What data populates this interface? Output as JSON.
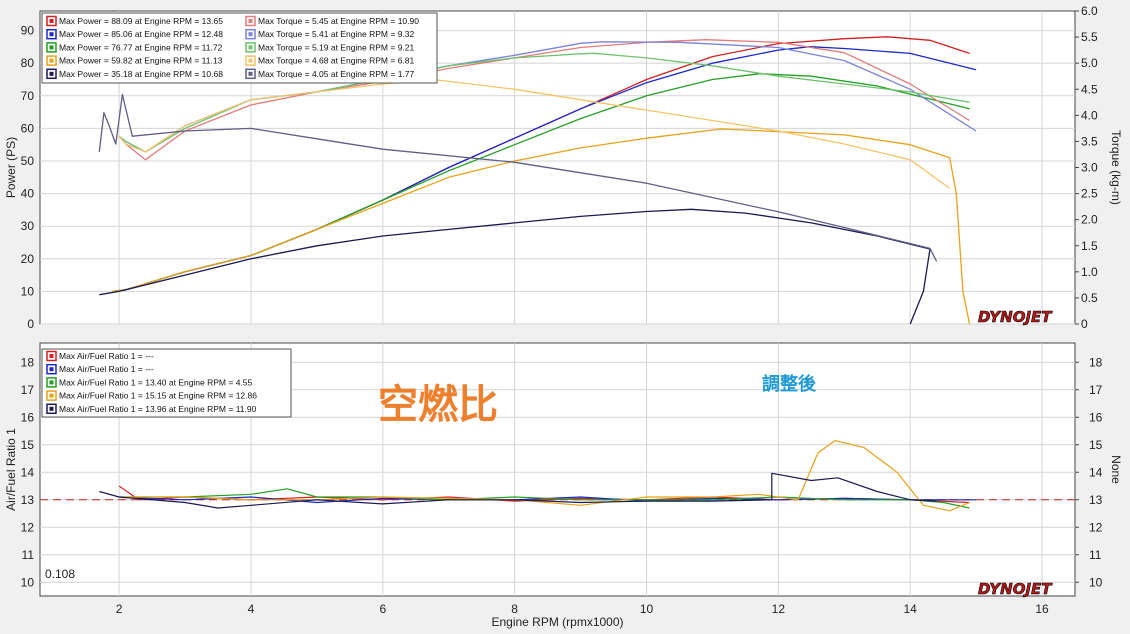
{
  "colors": {
    "red": "#d42020",
    "blue": "#1b28c8",
    "green": "#23a023",
    "orange": "#e8a21a",
    "navy": "#1a1a52",
    "red_torque": "#e57b7b",
    "blue_torque": "#7a84d9",
    "green_torque": "#6fc26f",
    "orange_torque": "#f2c469",
    "navy_torque": "#5e5e86",
    "annotation_orange": "#ee7f2d",
    "annotation_blue": "#1d9ad6",
    "af_reference": "#c82020"
  },
  "annotations": {
    "chart_title_jp": "空燃比",
    "status_jp": "調整後",
    "corner_value": "0.108",
    "logo": "DYNOJET"
  },
  "chart_data": [
    {
      "type": "line",
      "ylabel": "Power (PS)",
      "y2label": "Torque (kg-m)",
      "xlim": [
        0.8,
        16.5
      ],
      "ylim": [
        0,
        96
      ],
      "y2lim": [
        0,
        6.0
      ],
      "x_ticks": [
        "2",
        "4",
        "6",
        "8",
        "10",
        "12",
        "14",
        "16"
      ],
      "y_ticks": [
        "0",
        "10",
        "20",
        "30",
        "40",
        "50",
        "60",
        "70",
        "80",
        "90"
      ],
      "y2_ticks": [
        "0",
        "0.5",
        "1.0",
        "1.5",
        "2.0",
        "2.5",
        "3.0",
        "3.5",
        "4.0",
        "4.5",
        "5.0",
        "5.5",
        "6.0"
      ],
      "grid": true,
      "legend_position": "top-left",
      "legend": [
        [
          "Max Power = 88.09 at Engine RPM = 13.65",
          "Max Torque = 5.45 at Engine RPM = 10.90"
        ],
        [
          "Max Power = 85.06 at Engine RPM = 12.48",
          "Max Torque = 5.41 at Engine RPM = 9.32"
        ],
        [
          "Max Power = 76.77 at Engine RPM = 11.72",
          "Max Torque = 5.19 at Engine RPM = 9.21"
        ],
        [
          "Max Power = 59.82 at Engine RPM = 11.13",
          "Max Torque = 4.68 at Engine RPM = 6.81"
        ],
        [
          "Max Power = 35.18 at Engine RPM = 10.68",
          "Max Torque = 4.05 at Engine RPM = 1.77"
        ]
      ],
      "series": [
        {
          "color_key": "red",
          "axis": "left",
          "x": [
            1.9,
            2.1,
            3,
            4,
            5,
            6,
            7,
            8,
            9,
            10,
            11,
            12,
            13,
            13.65,
            14.3,
            14.9
          ],
          "y": [
            10,
            10.5,
            16,
            21,
            29,
            38,
            48,
            57,
            66,
            75,
            82,
            86,
            87.5,
            88.09,
            87,
            83
          ]
        },
        {
          "color_key": "blue",
          "axis": "left",
          "x": [
            1.9,
            2.1,
            3,
            4,
            5,
            6,
            7,
            8,
            9,
            10,
            11,
            12,
            12.48,
            13,
            14,
            15
          ],
          "y": [
            10,
            10.5,
            16,
            21,
            29,
            38,
            48,
            57,
            66,
            74,
            80,
            84,
            85.06,
            84.5,
            83,
            78
          ]
        },
        {
          "color_key": "green",
          "axis": "left",
          "x": [
            1.9,
            2.1,
            3,
            4,
            5,
            6,
            7,
            8,
            9,
            10,
            11,
            11.72,
            12.5,
            13.5,
            14.5,
            14.9
          ],
          "y": [
            10,
            10.5,
            16,
            21,
            29,
            38,
            47,
            55,
            63,
            70,
            75,
            76.77,
            76,
            73,
            68,
            66
          ]
        },
        {
          "color_key": "orange",
          "axis": "left",
          "x": [
            1.9,
            2.1,
            3,
            4,
            5,
            6,
            7,
            8,
            9,
            10,
            11.13,
            12,
            13,
            14,
            14.6,
            14.7,
            14.8,
            14.9
          ],
          "y": [
            10,
            10.5,
            16,
            21,
            29,
            37,
            45,
            50,
            54,
            57,
            59.82,
            59,
            58,
            55,
            51,
            40,
            10,
            0
          ]
        },
        {
          "color_key": "navy",
          "axis": "left",
          "x": [
            1.7,
            2.0,
            3,
            4,
            5,
            6,
            7,
            8,
            9,
            10,
            10.68,
            11.5,
            12.5,
            13.5,
            14.3,
            14.2,
            14.0
          ],
          "y": [
            9,
            10,
            15,
            20,
            24,
            27,
            29,
            31,
            33,
            34.5,
            35.18,
            34,
            31,
            27,
            23,
            10,
            0
          ]
        },
        {
          "color_key": "red_torque",
          "axis": "right",
          "x": [
            2.0,
            2.1,
            2.4,
            3,
            4,
            5,
            6,
            7,
            8,
            9,
            10,
            10.9,
            12,
            13,
            14,
            14.9
          ],
          "y": [
            3.6,
            3.45,
            3.15,
            3.7,
            4.2,
            4.45,
            4.65,
            4.9,
            5.1,
            5.3,
            5.4,
            5.45,
            5.4,
            5.2,
            4.6,
            3.9
          ]
        },
        {
          "color_key": "blue_torque",
          "axis": "right",
          "x": [
            2.0,
            2.1,
            2.4,
            3,
            4,
            5,
            6,
            7,
            8,
            9,
            9.32,
            10.5,
            12,
            13,
            14,
            15
          ],
          "y": [
            3.6,
            3.5,
            3.3,
            3.8,
            4.3,
            4.45,
            4.7,
            4.95,
            5.15,
            5.38,
            5.41,
            5.4,
            5.3,
            5.05,
            4.5,
            3.7
          ]
        },
        {
          "color_key": "green_torque",
          "axis": "right",
          "x": [
            2.0,
            2.1,
            2.4,
            3,
            4,
            5,
            6,
            7,
            8,
            9,
            9.21,
            10,
            11,
            12,
            13,
            14,
            14.9
          ],
          "y": [
            3.6,
            3.5,
            3.3,
            3.75,
            4.3,
            4.45,
            4.7,
            4.95,
            5.1,
            5.18,
            5.19,
            5.1,
            4.95,
            4.75,
            4.6,
            4.45,
            4.25
          ]
        },
        {
          "color_key": "orange_torque",
          "axis": "right",
          "x": [
            2.0,
            2.1,
            2.4,
            3,
            4,
            5,
            6,
            6.81,
            8,
            9,
            10,
            11,
            12,
            13,
            14,
            14.6
          ],
          "y": [
            3.6,
            3.45,
            3.3,
            3.8,
            4.3,
            4.45,
            4.6,
            4.68,
            4.5,
            4.3,
            4.1,
            3.9,
            3.7,
            3.45,
            3.15,
            2.6
          ]
        },
        {
          "color_key": "navy_torque",
          "axis": "right",
          "x": [
            1.7,
            1.77,
            1.85,
            1.95,
            2.05,
            2.2,
            3,
            4,
            5,
            6,
            8,
            10,
            12,
            13,
            14.3,
            14.4
          ],
          "y": [
            3.3,
            4.05,
            3.8,
            3.45,
            4.4,
            3.6,
            3.7,
            3.75,
            3.55,
            3.35,
            3.1,
            2.7,
            2.15,
            1.85,
            1.45,
            1.2
          ]
        }
      ]
    },
    {
      "type": "line",
      "ylabel": "Air/Fuel Ratio 1",
      "y2label": "None",
      "xlabel": "Engine RPM (rpmx1000)",
      "xlim": [
        0.8,
        16.5
      ],
      "ylim": [
        9.5,
        18.7
      ],
      "x_ticks": [
        "2",
        "4",
        "6",
        "8",
        "10",
        "12",
        "14",
        "16"
      ],
      "y_ticks": [
        "10",
        "11",
        "12",
        "13",
        "14",
        "15",
        "16",
        "17",
        "18"
      ],
      "reference_line": 13,
      "grid": true,
      "legend_position": "top-left",
      "legend": [
        "Max Air/Fuel Ratio 1 = ---",
        "Max Air/Fuel Ratio 1 = ---",
        "Max Air/Fuel Ratio 1 = 13.40 at Engine RPM = 4.55",
        "Max Air/Fuel Ratio 1 = 15.15 at Engine RPM = 12.86",
        "Max Air/Fuel Ratio 1 = 13.96 at Engine RPM = 11.90"
      ],
      "series": [
        {
          "color_key": "red",
          "x": [
            2.0,
            2.3,
            3,
            4,
            5,
            6,
            7,
            8,
            9,
            10,
            11,
            12,
            13,
            14,
            14.9
          ],
          "y": [
            13.5,
            13.0,
            13.1,
            13.0,
            13.1,
            13.0,
            13.1,
            12.95,
            13.05,
            13.0,
            13.1,
            13.0,
            13.05,
            13.0,
            12.9
          ]
        },
        {
          "color_key": "blue",
          "x": [
            2.0,
            3,
            4,
            5,
            6,
            7,
            8,
            9,
            10,
            11,
            12,
            13,
            14,
            15
          ],
          "y": [
            13.1,
            13.0,
            13.1,
            12.9,
            13.05,
            13.0,
            13.0,
            13.1,
            12.95,
            13.05,
            13.0,
            13.05,
            13.0,
            13.0
          ]
        },
        {
          "color_key": "green",
          "x": [
            2.0,
            3,
            4,
            4.55,
            5,
            6,
            7,
            8,
            9,
            10,
            11,
            12,
            13,
            14,
            14.5,
            14.9
          ],
          "y": [
            13.1,
            13.1,
            13.2,
            13.4,
            13.1,
            13.1,
            13.0,
            13.1,
            13.0,
            13.0,
            13.0,
            13.1,
            13.0,
            13.0,
            12.9,
            12.7
          ]
        },
        {
          "color_key": "orange",
          "x": [
            2.0,
            3,
            4,
            5,
            6,
            7,
            8,
            9,
            10,
            11,
            11.7,
            12.3,
            12.6,
            12.86,
            13.3,
            13.8,
            14.2,
            14.6,
            14.9
          ],
          "y": [
            13.1,
            13.1,
            13.0,
            13.0,
            13.1,
            13.05,
            13.0,
            12.8,
            13.1,
            13.1,
            13.2,
            13.0,
            14.7,
            15.15,
            14.9,
            14.0,
            12.8,
            12.6,
            12.9
          ]
        },
        {
          "color_key": "navy",
          "x": [
            1.7,
            2.0,
            3,
            3.5,
            4,
            5,
            6,
            7,
            8,
            9,
            10,
            11,
            11.9,
            11.9,
            12.5,
            12.9,
            13.5,
            14.0,
            14.4
          ],
          "y": [
            13.3,
            13.1,
            12.9,
            12.7,
            12.8,
            13.0,
            12.85,
            13.0,
            13.0,
            12.9,
            12.95,
            12.95,
            13.0,
            13.96,
            13.7,
            13.8,
            13.3,
            13.0,
            12.95
          ]
        }
      ]
    }
  ]
}
